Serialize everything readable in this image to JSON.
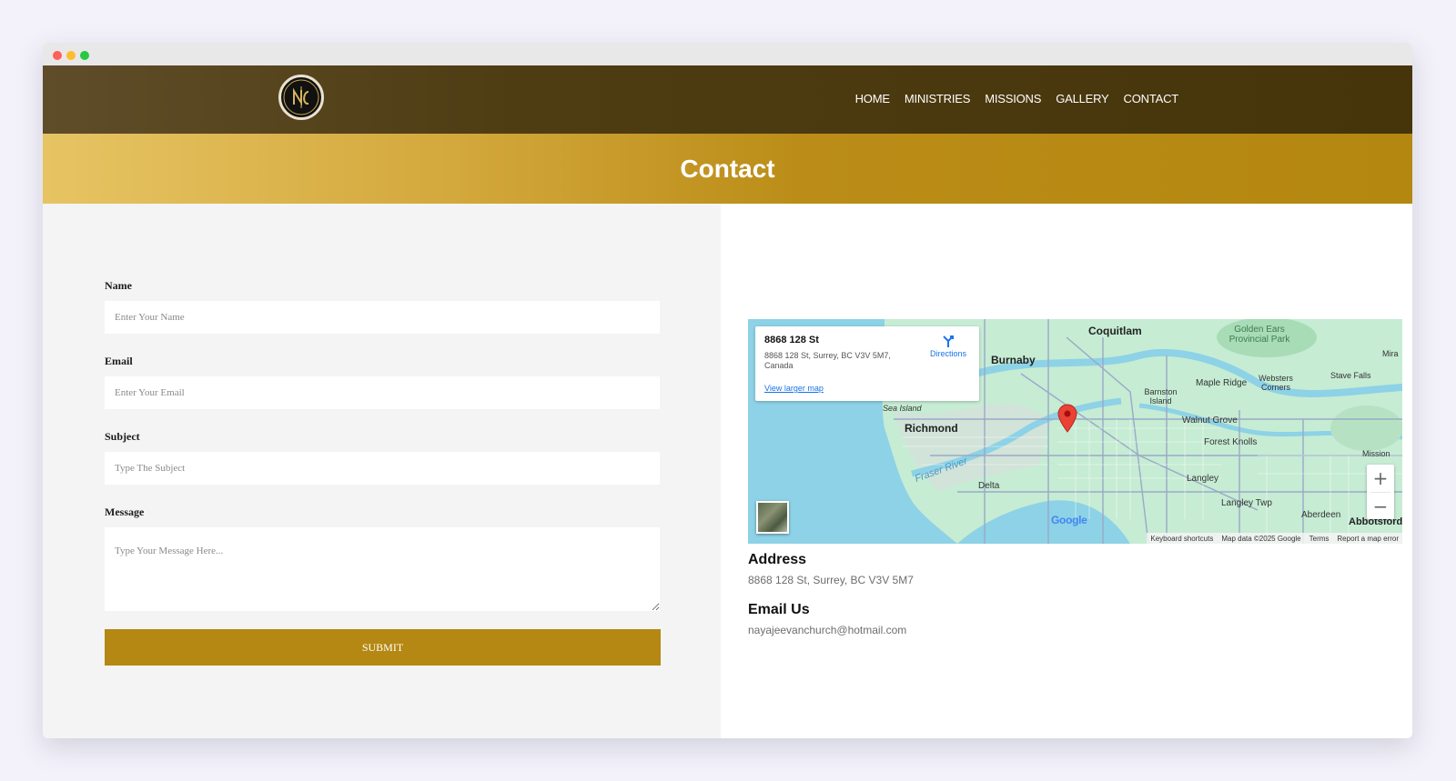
{
  "window": {
    "controls": [
      "close",
      "minimize",
      "maximize"
    ]
  },
  "header": {
    "logo_icon": "church-logo",
    "nav": [
      {
        "label": "HOME"
      },
      {
        "label": "MINISTRIES"
      },
      {
        "label": "MISSIONS"
      },
      {
        "label": "GALLERY"
      },
      {
        "label": "CONTACT"
      }
    ]
  },
  "hero": {
    "title": "Contact"
  },
  "form": {
    "name_label": "Name",
    "name_placeholder": "Enter Your Name",
    "email_label": "Email",
    "email_placeholder": "Enter Your Email",
    "subject_label": "Subject",
    "subject_placeholder": "Type The Subject",
    "message_label": "Message",
    "message_placeholder": "Type Your Message Here...",
    "submit_label": "SUBMIT"
  },
  "map": {
    "card_title": "8868 128 St",
    "card_address": "8868 128 St, Surrey, BC V3V 5M7, Canada",
    "directions_label": "Directions",
    "view_larger": "View larger map",
    "places": {
      "coquitlam": "Coquitlam",
      "burnaby": "Burnaby",
      "richmond": "Richmond",
      "sea_island": "Sea Island",
      "delta": "Delta",
      "barnston": "Barnston Island",
      "walnut": "Walnut Grove",
      "forest": "Forest Knolls",
      "langley": "Langley",
      "langley_twp": "Langley Twp",
      "aberdeen": "Aberdeen",
      "abbotsford": "Abbotsford",
      "maple": "Maple Ridge",
      "websters": "Websters Corners",
      "stave": "Stave Falls",
      "golden": "Golden Ears Provincial Park",
      "mission": "Mission",
      "mira": "Mira",
      "fraser": "Fraser River"
    },
    "zoom_in": "+",
    "zoom_out": "−",
    "google": "Google",
    "attrib": [
      "Keyboard shortcuts",
      "Map data ©2025 Google",
      "Terms",
      "Report a map error"
    ]
  },
  "contact": {
    "address_heading": "Address",
    "address_value": "8868 128 St, Surrey, BC V3V 5M7",
    "email_heading": "Email Us",
    "email_value": "nayajeevanchurch@hotmail.com"
  },
  "colors": {
    "nav_bg": "#4e3c12",
    "hero_gold": "#b48710",
    "submit": "#b48812",
    "map_water": "#8dd2e6",
    "map_land": "#c6ecd4"
  }
}
